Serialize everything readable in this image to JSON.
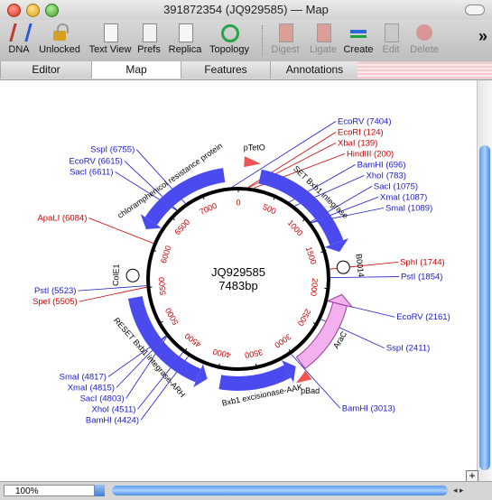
{
  "window": {
    "title": "391872354 (JQ929585) — Map"
  },
  "toolbar": [
    {
      "label": "DNA",
      "icon": "dna-icon",
      "enabled": true
    },
    {
      "label": "Unlocked",
      "icon": "unlocked-icon",
      "enabled": true
    },
    {
      "label": "Text View",
      "icon": "text-view-icon",
      "enabled": true
    },
    {
      "label": "Prefs",
      "icon": "prefs-icon",
      "enabled": true
    },
    {
      "label": "Replica",
      "icon": "replica-icon",
      "enabled": true
    },
    {
      "label": "Topology",
      "icon": "topology-icon",
      "enabled": true
    },
    {
      "label": "Digest",
      "icon": "digest-icon",
      "enabled": false
    },
    {
      "label": "Ligate",
      "icon": "ligate-icon",
      "enabled": false
    },
    {
      "label": "Create",
      "icon": "create-icon",
      "enabled": true
    },
    {
      "label": "Edit",
      "icon": "edit-icon",
      "enabled": false
    },
    {
      "label": "Delete",
      "icon": "delete-icon",
      "enabled": false
    }
  ],
  "overflow": "»",
  "tabs": [
    {
      "label": "Editor",
      "active": false
    },
    {
      "label": "Map",
      "active": true
    },
    {
      "label": "Features",
      "active": false
    },
    {
      "label": "Annotations",
      "active": false
    }
  ],
  "map": {
    "name": "JQ929585",
    "length_text": "7483bp",
    "length": 7483,
    "colors": {
      "site_single": "#cc0000",
      "site_double": "#1a1acc",
      "feature": "#4a4aee",
      "promoter": "#ee5555",
      "arac": "#f2b0ee"
    },
    "sites": [
      {
        "label": "EcoRV (7404)",
        "pos": 7404,
        "color": "blue"
      },
      {
        "label": "EcoRI (124)",
        "pos": 124,
        "color": "red"
      },
      {
        "label": "XbaI (139)",
        "pos": 139,
        "color": "red"
      },
      {
        "label": "HindIII (200)",
        "pos": 200,
        "color": "red"
      },
      {
        "label": "BamHI (696)",
        "pos": 696,
        "color": "blue"
      },
      {
        "label": "XhoI (783)",
        "pos": 783,
        "color": "blue"
      },
      {
        "label": "SacI (1075)",
        "pos": 1075,
        "color": "blue"
      },
      {
        "label": "XmaI (1087)",
        "pos": 1087,
        "color": "blue"
      },
      {
        "label": "SmaI (1089)",
        "pos": 1089,
        "color": "blue"
      },
      {
        "label": "SphI (1744)",
        "pos": 1744,
        "color": "red"
      },
      {
        "label": "PstI (1854)",
        "pos": 1854,
        "color": "blue"
      },
      {
        "label": "EcoRV (2161)",
        "pos": 2161,
        "color": "blue"
      },
      {
        "label": "SspI (2411)",
        "pos": 2411,
        "color": "blue"
      },
      {
        "label": "BamHI (3013)",
        "pos": 3013,
        "color": "blue"
      },
      {
        "label": "BamHI (4424)",
        "pos": 4424,
        "color": "blue"
      },
      {
        "label": "XhoI (4511)",
        "pos": 4511,
        "color": "blue"
      },
      {
        "label": "SacI (4803)",
        "pos": 4803,
        "color": "blue"
      },
      {
        "label": "XmaI (4815)",
        "pos": 4815,
        "color": "blue"
      },
      {
        "label": "SmaI (4817)",
        "pos": 4817,
        "color": "blue"
      },
      {
        "label": "SpeI (5505)",
        "pos": 5505,
        "color": "red"
      },
      {
        "label": "PstI (5523)",
        "pos": 5523,
        "color": "blue"
      },
      {
        "label": "ApaLI (6084)",
        "pos": 6084,
        "color": "red"
      },
      {
        "label": "SacI (6611)",
        "pos": 6611,
        "color": "blue"
      },
      {
        "label": "EcoRV (6615)",
        "pos": 6615,
        "color": "blue"
      },
      {
        "label": "SspI (6755)",
        "pos": 6755,
        "color": "blue"
      }
    ],
    "features": [
      {
        "label": "SET Bxb1 integrase",
        "start": 250,
        "end": 1560,
        "direction": "cw",
        "kind": "cds"
      },
      {
        "label": "AraC",
        "start": 2050,
        "end": 2980,
        "direction": "ccw",
        "kind": "arac"
      },
      {
        "label": "Bxb1 excisionase-AAK",
        "start": 3050,
        "end": 3950,
        "direction": "ccw",
        "kind": "cds"
      },
      {
        "label": "RESET Bxb1 integrase-ARH",
        "start": 4100,
        "end": 5400,
        "direction": "ccw",
        "kind": "cds"
      },
      {
        "label": "chloramphenicol resistance protein",
        "start": 6200,
        "end": 7320,
        "direction": "ccw",
        "kind": "cds"
      },
      {
        "label": "pTetO",
        "start": 60,
        "end": 230,
        "direction": "cw",
        "kind": "promoter"
      },
      {
        "label": "pBad",
        "start": 2990,
        "end": 3140,
        "direction": "ccw",
        "kind": "promoter"
      },
      {
        "label": "B0014",
        "start": 1700,
        "end": 1780,
        "direction": "none",
        "kind": "terminator"
      },
      {
        "label": "ColE1",
        "start": 5600,
        "end": 5700,
        "direction": "none",
        "kind": "terminator"
      }
    ],
    "ticks": [
      "0",
      "500",
      "1000",
      "1500",
      "2000",
      "2500",
      "3000",
      "3500",
      "4000",
      "4500",
      "5000",
      "5500",
      "6000",
      "6500",
      "7000"
    ]
  },
  "status": {
    "zoom": "100%",
    "h_arrows": "◂ ▸",
    "plus": "+"
  }
}
